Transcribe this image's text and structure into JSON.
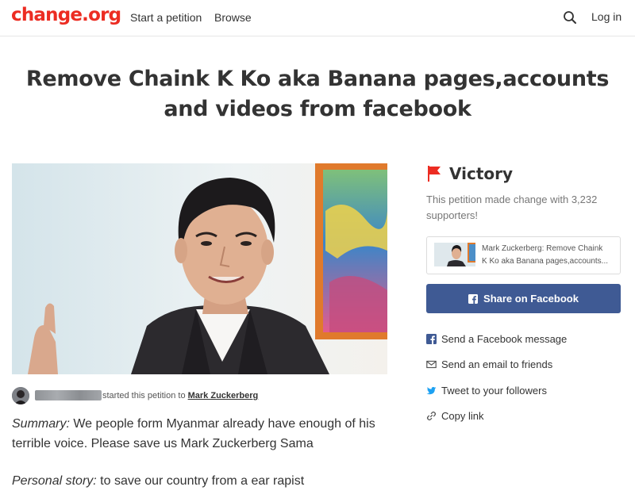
{
  "header": {
    "logo": "change.org",
    "nav": {
      "start_petition": "Start a petition",
      "browse": "Browse"
    },
    "login": "Log in",
    "search_icon": "search-icon"
  },
  "petition": {
    "title": "Remove Chaink K Ko aka Banana pages,accounts and videos from facebook",
    "author_line": "started this petition to",
    "target": "Mark Zuckerberg",
    "summary_label": "Summary:",
    "summary_text": " We people form Myanmar already have enough of his terrible voice. Please save us Mark Zuckerberg Sama",
    "story_label": "Personal story:",
    "story_text": " to save our country from a ear rapist"
  },
  "sidebar": {
    "status": "Victory",
    "status_text": "This petition made change with 3,232 supporters!",
    "card_text_line1": "Mark Zuckerberg: Remove Chaink",
    "card_text_line2": "K Ko aka Banana pages,accounts...",
    "share_facebook": "Share on Facebook",
    "share_items": {
      "facebook_message": "Send a Facebook message",
      "email": "Send an email to friends",
      "tweet": "Tweet to your followers",
      "copy": "Copy link"
    }
  },
  "colors": {
    "brand_red": "#ec2c22",
    "facebook_blue": "#3f5a94",
    "twitter_blue": "#1da1f2"
  }
}
